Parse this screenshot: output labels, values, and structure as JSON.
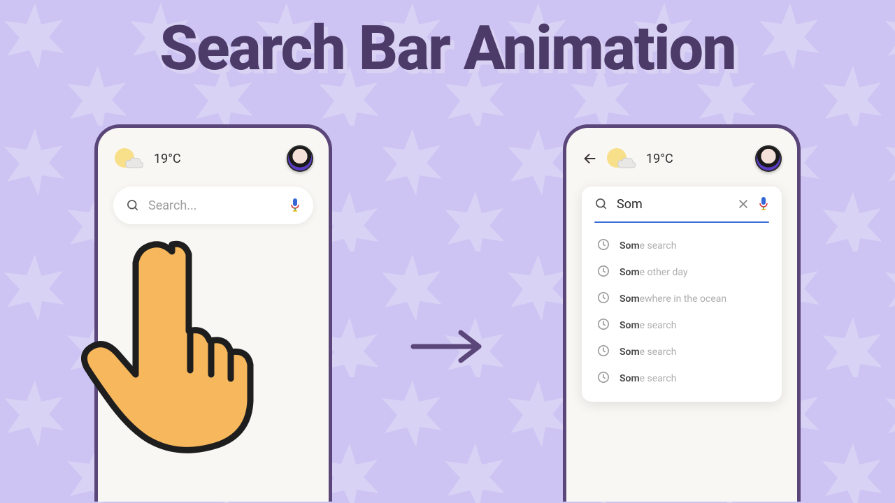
{
  "title": "Search Bar Animation",
  "weather": {
    "temp": "19°C"
  },
  "search": {
    "placeholder": "Search...",
    "typed": "Som"
  },
  "suggestions": [
    {
      "match": "Som",
      "rest": "e search"
    },
    {
      "match": "Som",
      "rest": "e other day"
    },
    {
      "match": "Som",
      "rest": "ewhere in the ocean"
    },
    {
      "match": "Som",
      "rest": "e search"
    },
    {
      "match": "Som",
      "rest": "e search"
    },
    {
      "match": "Som",
      "rest": "e search"
    }
  ],
  "colors": {
    "accent": "#5b467a",
    "bg": "#cdc4f3"
  }
}
